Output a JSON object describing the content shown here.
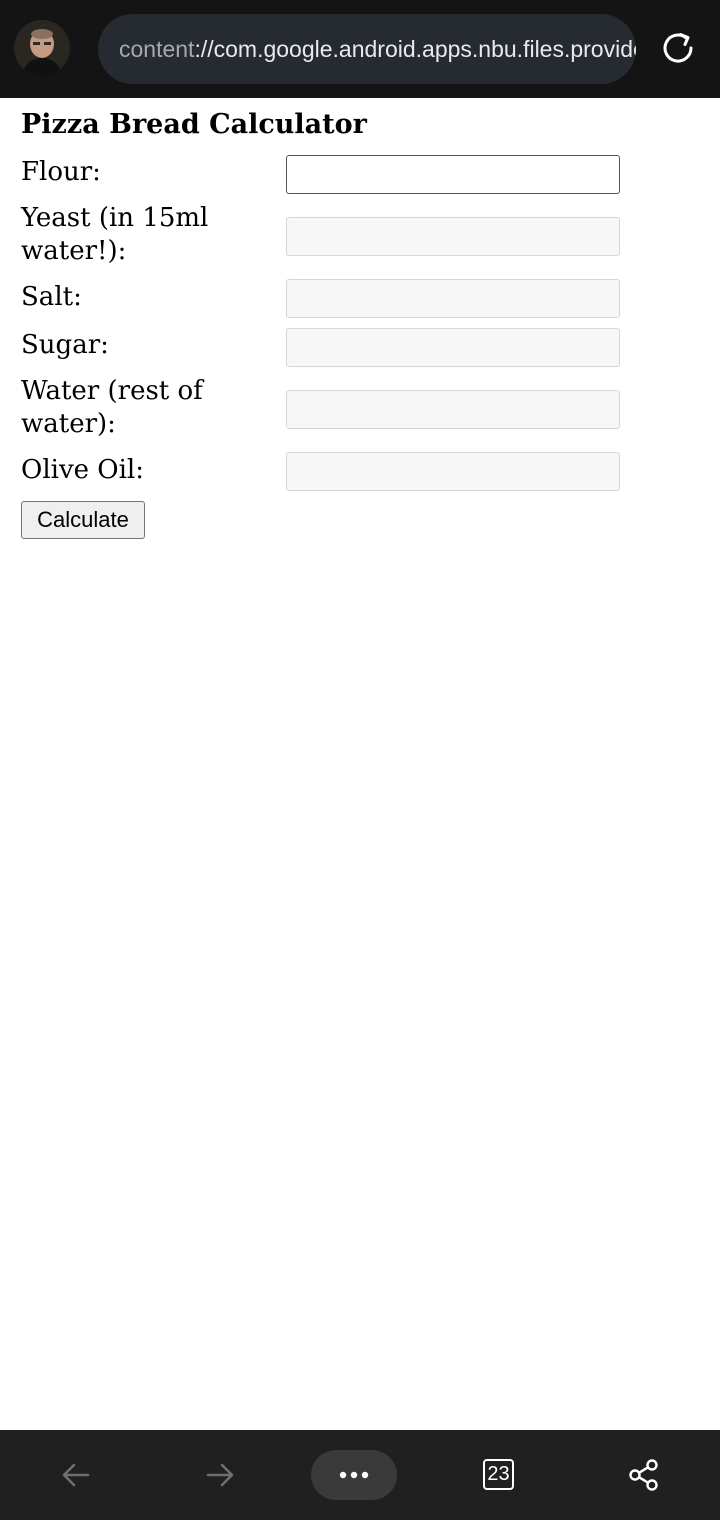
{
  "browser": {
    "url_scheme": "content",
    "url_rest": "://com.google.android.apps.nbu.files.provider/",
    "tab_count": "23"
  },
  "page": {
    "title": "Pizza Bread Calculator",
    "fields": [
      {
        "label": "Flour:",
        "value": ""
      },
      {
        "label": "Yeast (in 15ml water!):",
        "value": ""
      },
      {
        "label": "Salt:",
        "value": ""
      },
      {
        "label": "Sugar:",
        "value": ""
      },
      {
        "label": "Water (rest of water):",
        "value": ""
      },
      {
        "label": "Olive Oil:",
        "value": ""
      }
    ],
    "calculate_label": "Calculate"
  },
  "icons": {
    "avatar": "user-avatar",
    "reload": "reload-icon",
    "back": "back-arrow-icon",
    "forward": "forward-arrow-icon",
    "menu": "more-dots-icon",
    "tabs": "tabs-icon",
    "share": "share-icon"
  },
  "colors": {
    "topbar": "#141414",
    "urlbar": "#262b31",
    "bottombar": "#202020"
  }
}
